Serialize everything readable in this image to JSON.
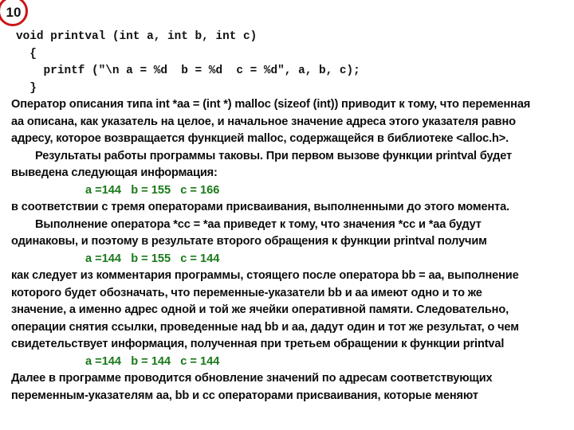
{
  "slide": {
    "number": "10",
    "badge_color": "#cc1414",
    "background": "#ffffff",
    "body_text_color": "#0d0d0d",
    "output_text_color": "#1a7a1a"
  },
  "code_block": {
    "lines": [
      "void printval (int a, int b, int c)",
      "  {",
      "    printf (\"\\n a = %d  b = %d  c = %d\", a, b, c);",
      "  }"
    ]
  },
  "body": {
    "lines": [
      {
        "text": "Оператор описания типа int *aa = (int *) malloc (sizeof (int)) приводит к тому, что переменная",
        "style": "normal"
      },
      {
        "text": "aa описана, как указатель на целое, и начальное значение адреса этого указателя равно",
        "style": "normal"
      },
      {
        "text": "адресу, которое возвращается функцией malloc, содержащейся в библиотеке <alloc.h>.",
        "style": "normal"
      },
      {
        "text": "Результаты работы программы таковы. При первом вызове функции printval будет",
        "style": "indent"
      },
      {
        "text": "выведена следующая информация:",
        "style": "normal"
      },
      {
        "text": "a =144   b = 155   c = 166",
        "style": "output"
      },
      {
        "text": "в соответствии с тремя операторами присваивания, выполненными до этого момента.",
        "style": "normal"
      },
      {
        "text": "Выполнение оператора *cc = *aa приведет к тому, что значения *cc и *aa будут",
        "style": "indent"
      },
      {
        "text": "одинаковы, и поэтому в результате второго обращения к функции printval получим",
        "style": "normal"
      },
      {
        "text": "a =144   b = 155   c = 144",
        "style": "output"
      },
      {
        "text": "как следует из комментария программы, стоящего после оператора bb = aa, выполнение",
        "style": "normal"
      },
      {
        "text": "которого будет обозначать, что переменные-указатели bb и aa имеют одно и то же",
        "style": "normal"
      },
      {
        "text": "значение, а именно адрес одной и той же ячейки оперативной памяти. Следовательно,",
        "style": "normal"
      },
      {
        "text": "операции снятия ссылки, проведенные над bb и aa, дадут один и тот же результат, о чем",
        "style": "normal"
      },
      {
        "text": "свидетельствует информация, полученная при третьем обращении к функции printval",
        "style": "normal"
      },
      {
        "text": "a =144   b = 144   c = 144",
        "style": "output"
      },
      {
        "text": "Далее в программе проводится обновление значений по адресам соответствующих",
        "style": "normal"
      },
      {
        "text": "переменным-указателям aa, bb и cc операторами присваивания, которые меняют",
        "style": "normal"
      }
    ]
  }
}
